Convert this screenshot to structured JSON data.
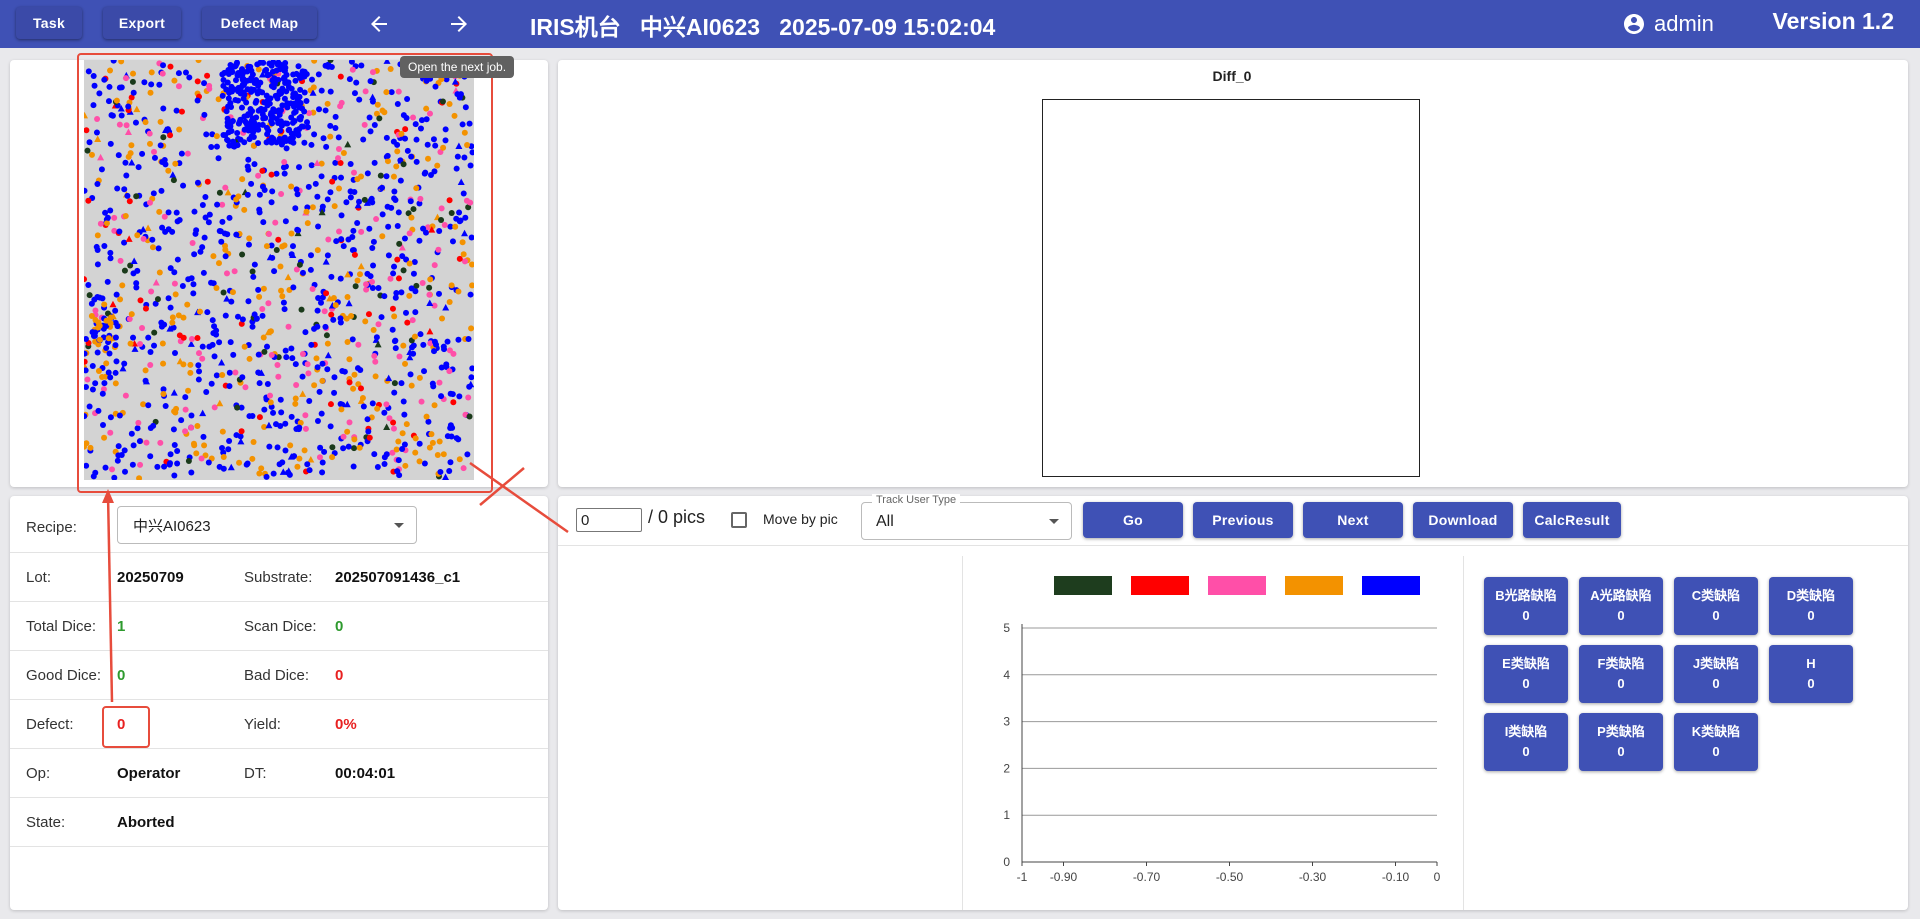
{
  "header": {
    "buttons": [
      "Task",
      "Export",
      "Defect Map"
    ],
    "title": "IRIS机台   中兴AI0623   2025-07-09 15:02:04",
    "user": "admin",
    "version": "Version 1.2",
    "icons": {
      "back": "arrow-back-icon",
      "forward": "arrow-forward-icon",
      "user": "account-circle-icon"
    }
  },
  "map": {
    "tooltip": "Open the next job.",
    "background": "#d3d3d3",
    "point_colors": [
      "#1a3a1a",
      "#ff0000",
      "#ff4fa8",
      "#f39200",
      "#0000ff"
    ]
  },
  "diff": {
    "title": "Diff_0"
  },
  "info": {
    "recipe_label": "Recipe:",
    "recipe_value": "中兴AI0623",
    "lot_label": "Lot:",
    "lot_value": "20250709",
    "substrate_label": "Substrate:",
    "substrate_value": "202507091436_c1",
    "total_dice_label": "Total Dice:",
    "total_dice_value": "1",
    "scan_dice_label": "Scan Dice:",
    "scan_dice_value": "0",
    "good_dice_label": "Good Dice:",
    "good_dice_value": "0",
    "bad_dice_label": "Bad Dice:",
    "bad_dice_value": "0",
    "defect_label": "Defect:",
    "defect_value": "0",
    "yield_label": "Yield:",
    "yield_value": "0%",
    "op_label": "Op:",
    "op_value": "Operator",
    "dt_label": "DT:",
    "dt_value": "00:04:01",
    "state_label": "State:",
    "state_value": "Aborted"
  },
  "controls": {
    "pic_index": "0",
    "pics_label": "/ 0 pics",
    "move_by_pic_label": "Move by pic",
    "track_user_type_label": "Track User Type",
    "track_user_type_value": "All",
    "buttons": [
      "Go",
      "Previous",
      "Next",
      "Download",
      "CalcResult"
    ]
  },
  "chart_data": {
    "type": "bar",
    "series": [
      {
        "color": "#1e3d1e",
        "values": []
      },
      {
        "color": "#ff0000",
        "values": []
      },
      {
        "color": "#ff4fa8",
        "values": []
      },
      {
        "color": "#f39200",
        "values": []
      },
      {
        "color": "#0000ff",
        "values": []
      }
    ],
    "y_ticks": [
      "0",
      "1",
      "2",
      "3",
      "4",
      "5"
    ],
    "x_ticks": [
      "-1",
      "-0.90",
      "-0.70",
      "-0.50",
      "-0.30",
      "-0.10",
      "0"
    ],
    "ylim": [
      0,
      5
    ],
    "xlim": [
      -1,
      0
    ],
    "grid": true,
    "legend_position": "top"
  },
  "defect_categories": [
    {
      "name": "B光路缺陷",
      "count": "0"
    },
    {
      "name": "A光路缺陷",
      "count": "0"
    },
    {
      "name": "C类缺陷",
      "count": "0"
    },
    {
      "name": "D类缺陷",
      "count": "0"
    },
    {
      "name": "E类缺陷",
      "count": "0"
    },
    {
      "name": "F类缺陷",
      "count": "0"
    },
    {
      "name": "J类缺陷",
      "count": "0"
    },
    {
      "name": "H",
      "count": "0"
    },
    {
      "name": "I类缺陷",
      "count": "0"
    },
    {
      "name": "P类缺陷",
      "count": "0"
    },
    {
      "name": "K类缺陷",
      "count": "0"
    }
  ]
}
